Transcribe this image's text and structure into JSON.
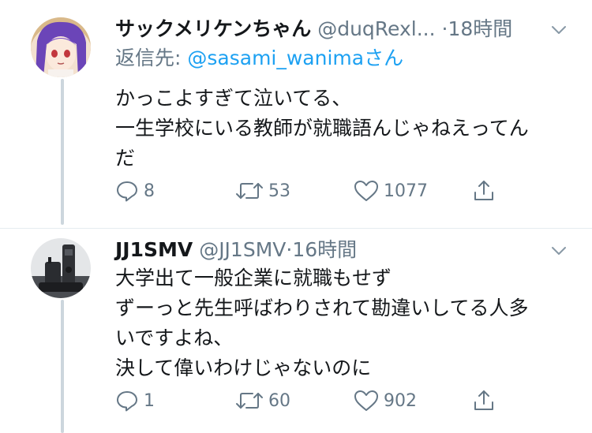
{
  "tweets": [
    {
      "display_name": "サックメリケンちゃん",
      "handle": "@duqRexl...",
      "separator": "·",
      "time": "18時間",
      "reply_prefix": "返信先: ",
      "reply_to": "@sasami_wanima",
      "reply_suffix": "さん",
      "lines": [
        "かっこよすぎて泣いてる、",
        "一生学校にいる教師が就職語んじゃねえってん",
        "だ"
      ],
      "replies": "8",
      "retweets": "53",
      "likes": "1077"
    },
    {
      "display_name": "JJ1SMV",
      "handle": "@JJ1SMV",
      "separator": "·",
      "time": "16時間",
      "lines": [
        "大学出て一般企業に就職もせず",
        "ずーっと先生呼ばわりされて勘違いしてる人多",
        "いですよね、",
        "決して偉いわけじゃないのに"
      ],
      "replies": "1",
      "retweets": "60",
      "likes": "902"
    }
  ],
  "colors": {
    "text": "#14171a",
    "secondary": "#657786",
    "link": "#1da1f2",
    "thread": "#ccd6dd"
  },
  "icons": [
    "chevron-down-icon",
    "reply-icon",
    "retweet-icon",
    "like-icon",
    "share-icon"
  ]
}
